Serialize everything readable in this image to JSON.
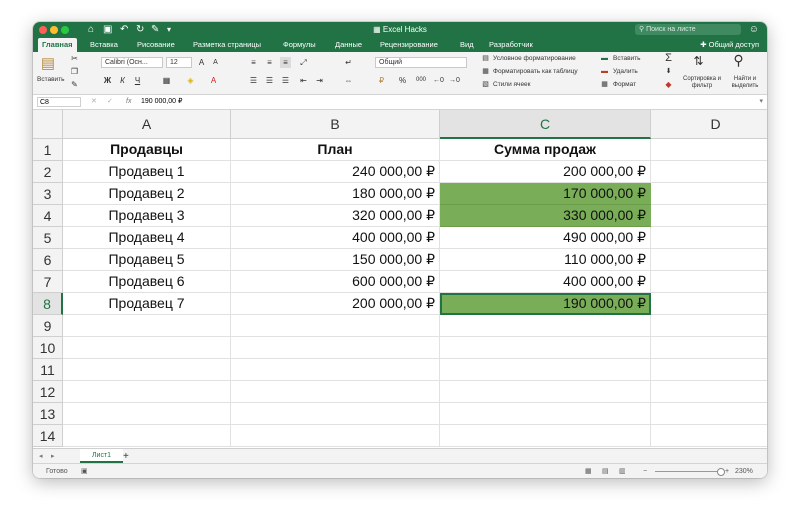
{
  "window": {
    "title": "Excel Hacks"
  },
  "colors": {
    "accent": "#217346",
    "highlight": "#79ad57"
  },
  "search": {
    "placeholder": "Поиск на листе"
  },
  "ribbon_tabs": [
    "Главная",
    "Вставка",
    "Рисование",
    "Разметка страницы",
    "Формулы",
    "Данные",
    "Рецензирование",
    "Вид",
    "Разработчик"
  ],
  "share_label": "Общий доступ",
  "ribbon": {
    "paste_label": "Вставить",
    "font_name": "Calibri (Осн...",
    "font_size": "12",
    "bold": "Ж",
    "italic": "К",
    "underline": "Ч",
    "number_format": "Общий",
    "percent": "%",
    "thousands": "000",
    "cond_format": "Условное форматирование",
    "format_table": "Форматировать как таблицу",
    "cell_styles": "Стили ячеек",
    "insert": "Вставить",
    "delete": "Удалить",
    "format": "Формат",
    "sort_filter": "Сортировка и фильтр",
    "find_select": "Найти и выделить"
  },
  "formula_bar": {
    "name_box": "C8",
    "fx": "fx",
    "value": "190 000,00 ₽"
  },
  "columns": [
    "A",
    "B",
    "C",
    "D"
  ],
  "rows": [
    "1",
    "2",
    "3",
    "4",
    "5",
    "6",
    "7",
    "8",
    "9",
    "10",
    "11",
    "12",
    "13",
    "14"
  ],
  "table": {
    "headers": [
      "Продавцы",
      "План",
      "Сумма продаж"
    ],
    "rows": [
      [
        "Продавец 1",
        "240 000,00 ₽",
        "200 000,00 ₽"
      ],
      [
        "Продавец 2",
        "180 000,00 ₽",
        "170 000,00 ₽"
      ],
      [
        "Продавец 3",
        "320 000,00 ₽",
        "330 000,00 ₽"
      ],
      [
        "Продавец 4",
        "400 000,00 ₽",
        "490 000,00 ₽"
      ],
      [
        "Продавец 5",
        "150 000,00 ₽",
        "110 000,00 ₽"
      ],
      [
        "Продавец 6",
        "600 000,00 ₽",
        "400 000,00 ₽"
      ],
      [
        "Продавец 7",
        "200 000,00 ₽",
        "190 000,00 ₽"
      ]
    ]
  },
  "sheet_tabs": [
    "Лист1"
  ],
  "add_sheet": "+",
  "status": {
    "ready": "Готово",
    "zoom": "230%"
  }
}
